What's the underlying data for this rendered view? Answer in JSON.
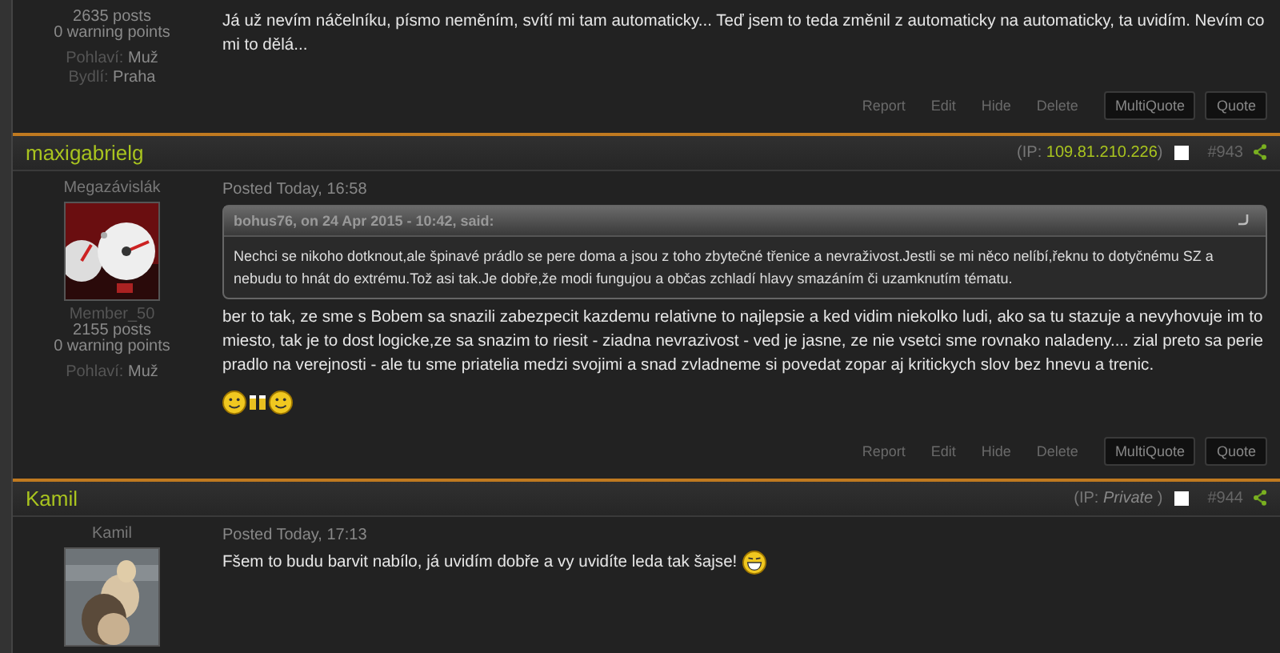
{
  "posts": [
    {
      "header": false,
      "stats": {
        "posts": "2635 posts",
        "warnings": "0 warning points"
      },
      "profile_fields": [
        {
          "label": "Pohlaví:",
          "value": "Muž"
        },
        {
          "label": "Bydlí:",
          "value": "Praha"
        }
      ],
      "body": "Já už nevím náčelníku, písmo neměním, svítí mi tam automaticky... Teď jsem to teda změnil z automaticky na automaticky, ta uvidím. Nevím co mi to dělá...",
      "actions": [
        {
          "label": "Report",
          "kind": "link"
        },
        {
          "label": "Edit",
          "kind": "link"
        },
        {
          "label": "Hide",
          "kind": "link"
        },
        {
          "label": "Delete",
          "kind": "link"
        },
        {
          "label": "MultiQuote",
          "kind": "button"
        },
        {
          "label": "Quote",
          "kind": "button"
        }
      ]
    },
    {
      "header": true,
      "author": "maxigabrielg",
      "ip_prefix": "(IP:",
      "ip": "109.81.210.226",
      "ip_private": false,
      "ip_suffix": ")",
      "checked": false,
      "post_number": "#943",
      "rank": "Megazávislák",
      "avatar": {
        "kind": "picture"
      },
      "member_group": "Member_50",
      "stats": {
        "posts": "2155 posts",
        "warnings": "0 warning points"
      },
      "profile_fields": [
        {
          "label": "Pohlaví:",
          "value": "Muž"
        }
      ],
      "posted": "Posted Today, 16:58",
      "quote": {
        "citation": "bohus76, on 24 Apr 2015 - 10:42, said:",
        "text": "Nechci se nikoho dotknout,ale špinavé prádlo se pere doma a jsou z toho zbytečné třenice a nevraživost.Jestli se mi něco nelíbí,řeknu to dotyčnému SZ a nebudu to hnát do extrému.Tož asi tak.Je dobře,že modi fungujou a občas zchladí hlavy smazáním či uzamknutím tématu."
      },
      "body": "ber to tak, ze sme s Bobem sa snazili zabezpecit kazdemu relativne to najlepsie a ked vidim niekolko ludi, ako sa tu stazuje a nevyhovuje im to miesto, tak je to dost logicke,ze sa snazim to riesit - ziadna nevrazivost - ved je jasne, ze nie vsetci sme rovnako naladeny.... zial preto sa perie pradlo na verejnosti - ale tu sme priatelia medzi svojimi a snad zvladneme si povedat zopar aj kritickych slov bez hnevu a trenic.",
      "emoticon_row": true,
      "actions": [
        {
          "label": "Report",
          "kind": "link"
        },
        {
          "label": "Edit",
          "kind": "link"
        },
        {
          "label": "Hide",
          "kind": "link"
        },
        {
          "label": "Delete",
          "kind": "link"
        },
        {
          "label": "MultiQuote",
          "kind": "button"
        },
        {
          "label": "Quote",
          "kind": "button"
        }
      ]
    },
    {
      "header": true,
      "author": "Kamil",
      "ip_prefix": "(IP:",
      "ip": "Private",
      "ip_private": true,
      "ip_suffix": ")",
      "checked": false,
      "post_number": "#944",
      "rank": "Kamil",
      "avatar": {
        "kind": "picture"
      },
      "posted": "Posted Today, 17:13",
      "body": "Fšem to budu barvit nabílo, já uvidím dobře a vy uvidíte leda tak šajse!",
      "inline_emoticon": true
    }
  ]
}
